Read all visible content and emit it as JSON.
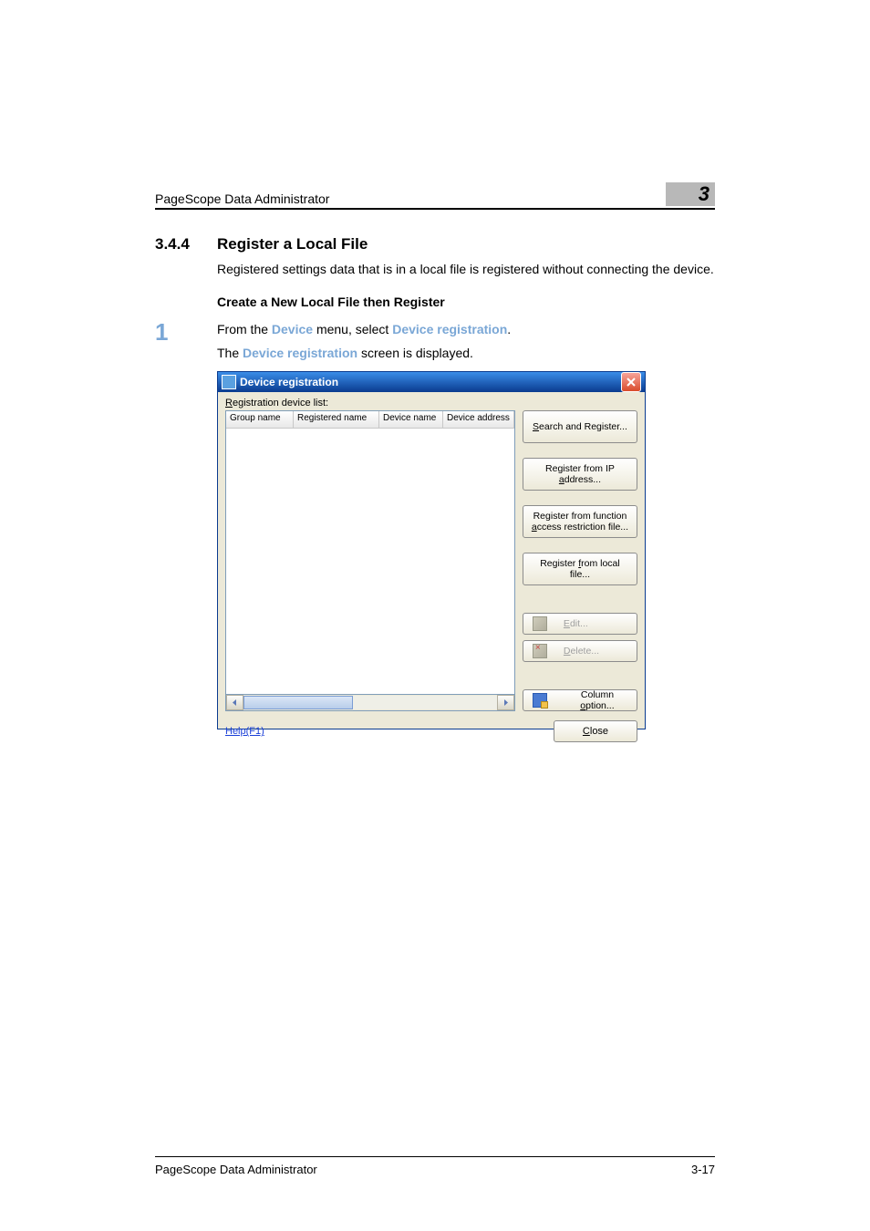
{
  "header": {
    "running_title": "PageScope Data Administrator",
    "chapter_number": "3"
  },
  "section": {
    "number": "3.4.4",
    "title": "Register a Local File",
    "intro": "Registered settings data that is in a local file is registered without connecting the device.",
    "subheading": "Create a New Local File then Register"
  },
  "step": {
    "number": "1",
    "line1_prefix": "From the ",
    "line1_ui1": "Device",
    "line1_mid": " menu, select ",
    "line1_ui2": "Device registration",
    "line1_suffix": ".",
    "line2_prefix": "The ",
    "line2_ui": "Device registration",
    "line2_suffix": " screen is displayed."
  },
  "dialog": {
    "title": "Device registration",
    "list_label_pre": "R",
    "list_label_rest": "egistration device list:",
    "columns": [
      "Group name",
      "Registered name",
      "Device name",
      "Device address"
    ],
    "buttons": {
      "search": {
        "pre": "S",
        "rest": "earch and Register..."
      },
      "ip1": "Register from IP",
      "ip2_pre": "a",
      "ip2_rest": "ddress...",
      "func1": "Register from function",
      "func2_pre": "a",
      "func2_rest": "ccess restriction file...",
      "local_pre": "Register ",
      "local_u": "f",
      "local_rest": "rom local file...",
      "edit_pre": "E",
      "edit_rest": "dit...",
      "delete_pre": "D",
      "delete_rest": "elete...",
      "column_pre": "Column ",
      "column_u": "o",
      "column_rest": "ption..."
    },
    "help": "Help(F1)",
    "close_pre": "C",
    "close_rest": "lose"
  },
  "footer": {
    "left": "PageScope Data Administrator",
    "right": "3-17"
  }
}
